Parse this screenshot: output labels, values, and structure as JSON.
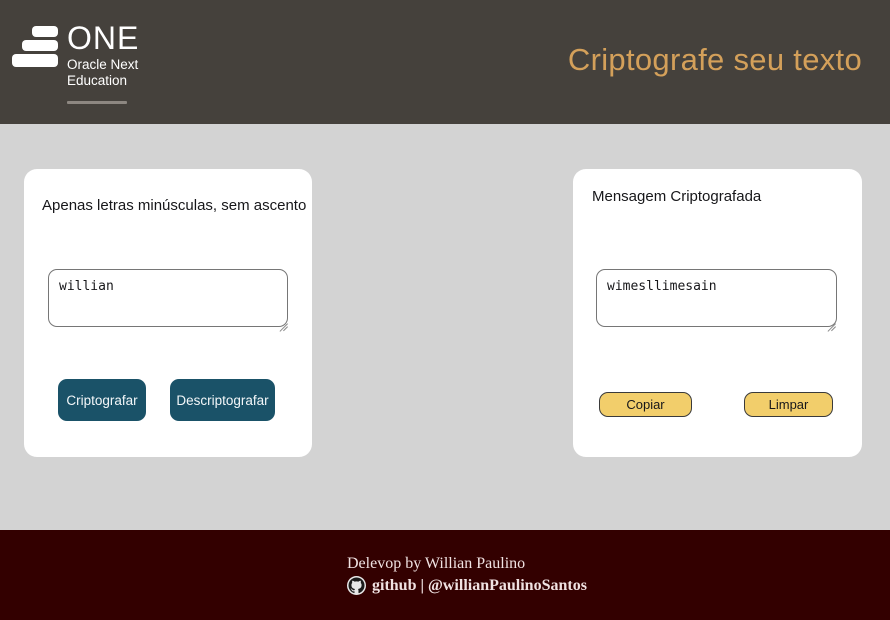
{
  "header": {
    "logo": {
      "mark_icon": "one-stack-icon",
      "title": "ONE",
      "subtitle_line1": "Oracle Next",
      "subtitle_line2": "Education"
    },
    "title": "Criptografe seu texto",
    "background_color": "#45413C",
    "title_color": "#D4A05A"
  },
  "main": {
    "background_color": "#D3D3D3",
    "input_card": {
      "label": "Apenas letras minúsculas, sem ascento",
      "textarea": {
        "value": "willian",
        "placeholder": "Digite seu texto"
      },
      "buttons": [
        {
          "label": "Criptografar",
          "color": "#1A5268"
        },
        {
          "label": "Descriptografar",
          "color": "#1A5268"
        }
      ]
    },
    "output_card": {
      "label": "Mensagem Criptografada",
      "textarea": {
        "value": "wimesllimesain",
        "placeholder": "Nenhuma mensagem encontrada"
      },
      "buttons": [
        {
          "label": "Copiar",
          "color": "#F2CE6B"
        },
        {
          "label": "Limpar",
          "color": "#F2CE6B"
        }
      ]
    }
  },
  "footer": {
    "background_color": "#330000",
    "credit": "Delevop by Willian Paulino",
    "github_icon": "github-icon",
    "handle": "github | @willianPaulinoSantos"
  }
}
